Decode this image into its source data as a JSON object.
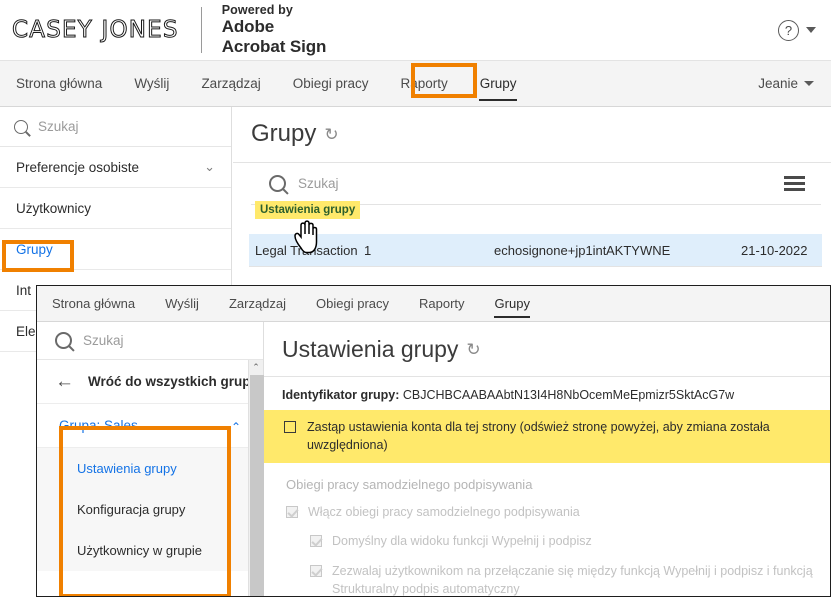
{
  "header": {
    "logo_text": "CASEY JONES",
    "powered_by": "Powered by",
    "brand_line1": "Adobe",
    "brand_line2": "Acrobat Sign",
    "help_icon": "help-circle-icon",
    "help_caret": "chevron-down-icon"
  },
  "main_nav": {
    "items": [
      {
        "label": "Strona główna",
        "active": false
      },
      {
        "label": "Wyślij",
        "active": false
      },
      {
        "label": "Zarządzaj",
        "active": false
      },
      {
        "label": "Obiegi pracy",
        "active": false
      },
      {
        "label": "Raporty",
        "active": false
      },
      {
        "label": "Grupy",
        "active": true
      }
    ],
    "user": "Jeanie"
  },
  "sidebar": {
    "search_placeholder": "Szukaj",
    "items": [
      {
        "label": "Preferencje osobiste",
        "chevron": "⌄",
        "selected": false
      },
      {
        "label": "Użytkownicy",
        "chevron": "",
        "selected": false
      },
      {
        "label": "Grupy",
        "chevron": "",
        "selected": true
      },
      {
        "label": "Int",
        "chevron": "",
        "selected": false
      },
      {
        "label": "Ele",
        "chevron": "",
        "selected": false
      }
    ]
  },
  "main": {
    "title": "Grupy",
    "refresh_icon": "↻",
    "search_placeholder": "Szukaj",
    "menu_icon": "hamburger-menu-icon",
    "tooltip": "Ustawienia grupy",
    "row": {
      "name": "Legal Transaction",
      "count": "1",
      "email": "echosignone+jp1inte",
      "status": "AKTYWNE",
      "date": "21-10-2022"
    }
  },
  "overlay": {
    "nav": {
      "items": [
        {
          "label": "Strona główna",
          "active": false
        },
        {
          "label": "Wyślij",
          "active": false
        },
        {
          "label": "Zarządzaj",
          "active": false
        },
        {
          "label": "Obiegi pracy",
          "active": false
        },
        {
          "label": "Raporty",
          "active": false
        },
        {
          "label": "Grupy",
          "active": true
        }
      ]
    },
    "sidebar": {
      "search_placeholder": "Szukaj",
      "back_label": "Wróć do wszystkich grup",
      "back_icon": "arrow-left-icon",
      "group_label": "Grupa: Sales",
      "group_chevron": "⌃",
      "sub_items": [
        {
          "label": "Ustawienia grupy",
          "selected": true
        },
        {
          "label": "Konfiguracja grupy",
          "selected": false
        },
        {
          "label": "Użytkownicy w grupie",
          "selected": false
        }
      ],
      "scroll_up_icon": "⌃"
    },
    "content": {
      "title": "Ustawienia grupy",
      "refresh_icon": "↻",
      "group_id_label": "Identyfikator grupy:",
      "group_id_value": "CBJCHBCAABAAbtN13I4H8NbOcemMeEpmizr5SktAcG7w",
      "override_text": "Zastąp ustawienia konta dla tej strony (odśwież stronę powyżej, aby zmiana została uwzględniona)",
      "section_title": "Obiegi pracy samodzielnego podpisywania",
      "options": [
        {
          "label": "Włącz obiegi pracy samodzielnego podpisywania",
          "level": 1,
          "checked": true
        },
        {
          "label": "Domyślny dla widoku funkcji Wypełnij i podpisz",
          "level": 2,
          "checked": true
        },
        {
          "label": "Zezwalaj użytkownikom na przełączanie się między funkcją Wypełnij i podpisz i funkcją Strukturalny podpis automatyczny",
          "level": 2,
          "checked": true
        }
      ]
    }
  },
  "colors": {
    "highlight_orange": "#f08000",
    "highlight_yellow": "#ffe96b",
    "link_blue": "#1473e6",
    "row_blue": "#dfeefb"
  }
}
